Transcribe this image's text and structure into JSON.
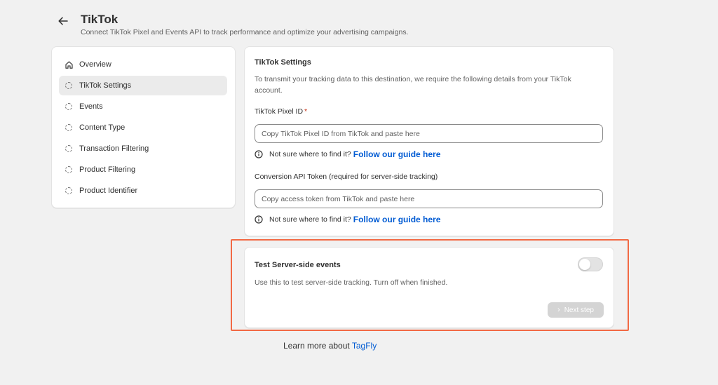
{
  "header": {
    "title": "TikTok",
    "subtitle": "Connect TikTok Pixel and Events API to track performance and optimize your advertising campaigns."
  },
  "sidebar": {
    "items": [
      {
        "label": "Overview",
        "icon": "home-icon"
      },
      {
        "label": "TikTok Settings",
        "icon": "dashed-circle-icon",
        "active": true
      },
      {
        "label": "Events",
        "icon": "dashed-circle-icon"
      },
      {
        "label": "Content Type",
        "icon": "dashed-circle-icon"
      },
      {
        "label": "Transaction Filtering",
        "icon": "dashed-circle-icon"
      },
      {
        "label": "Product Filtering",
        "icon": "dashed-circle-icon"
      },
      {
        "label": "Product Identifier",
        "icon": "dashed-circle-icon"
      }
    ]
  },
  "settings": {
    "title": "TikTok Settings",
    "description": "To transmit your tracking data to this destination, we require the following details from your TikTok account.",
    "pixel_label": "TikTok Pixel ID",
    "pixel_required_mark": "*",
    "pixel_placeholder": "Copy TikTok Pixel ID from TikTok and paste here",
    "pixel_value": "",
    "token_label": "Conversion API Token (required for server-side tracking)",
    "token_placeholder": "Copy access token from TikTok and paste here",
    "token_value": "",
    "help_text": "Not sure where to find it?",
    "help_link": "Follow our guide here"
  },
  "test_events": {
    "title": "Test Server-side events",
    "description": "Use this to test server-side tracking. Turn off when finished.",
    "toggle_on": false,
    "next_button": "Next step"
  },
  "footer": {
    "learn_text": "Learn more about",
    "learn_link": "TagFly"
  },
  "colors": {
    "link": "#005bd3",
    "highlight_border": "#f26944",
    "required": "#c5280c",
    "background": "#f1f1f1"
  }
}
